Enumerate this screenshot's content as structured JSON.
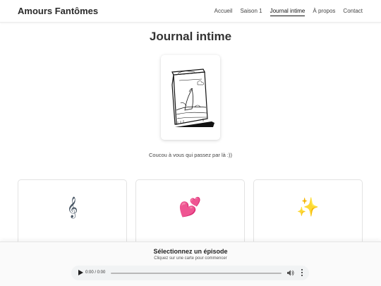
{
  "header": {
    "brand": "Amours Fantômes",
    "nav": [
      {
        "label": "Accueil",
        "active": false
      },
      {
        "label": "Saison 1",
        "active": false
      },
      {
        "label": "Journal intime",
        "active": true
      },
      {
        "label": "À propos",
        "active": false
      },
      {
        "label": "Contact",
        "active": false
      }
    ]
  },
  "main": {
    "title": "Journal intime",
    "cover_icon": "sketched-notebook-illustration",
    "tagline": "Coucou à vous qui passez par là :))",
    "episodes": [
      {
        "icon": "treble-clef-icon",
        "glyph": "𝄞"
      },
      {
        "icon": "two-hearts-icon",
        "glyph": "💕"
      },
      {
        "icon": "sparkles-icon",
        "glyph": "✨"
      }
    ]
  },
  "player": {
    "title": "Sélectionnez un épisode",
    "subtitle": "Cliquez sur une carte pour commencer",
    "time": "0:00 / 0:00",
    "icons": [
      "play-icon",
      "volume-icon",
      "more-vertical-icon"
    ]
  },
  "colors": {
    "text": "#333333",
    "nav_active_underline": "#111111",
    "player_bg": "#fafafa",
    "audio_bg": "#f1f3f4"
  }
}
